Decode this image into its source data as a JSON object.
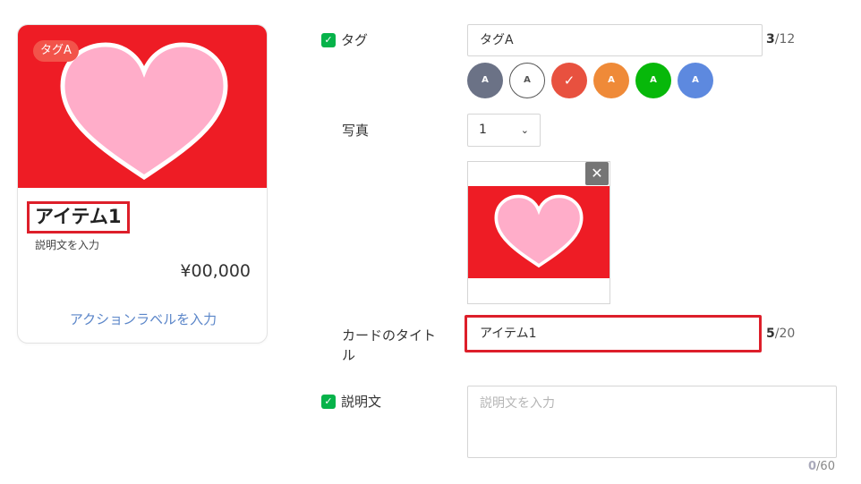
{
  "preview_card": {
    "tag": "タグA",
    "title": "アイテム1",
    "description": "説明文を入力",
    "price": "¥00,000",
    "action_label": "アクションラベルを入力"
  },
  "form": {
    "tag": {
      "label": "タグ",
      "value": "タグA",
      "counter_current": "3",
      "counter_max": "/12",
      "enabled": true
    },
    "tag_colors": [
      {
        "text": "A",
        "color": "#6b7286",
        "selected": false
      },
      {
        "text": "A",
        "color": "#ffffff",
        "selected": false
      },
      {
        "text": "✓",
        "color": "#e8513f",
        "selected": true
      },
      {
        "text": "A",
        "color": "#ef8a38",
        "selected": false
      },
      {
        "text": "A",
        "color": "#07b80a",
        "selected": false
      },
      {
        "text": "A",
        "color": "#5d89df",
        "selected": false
      }
    ],
    "photo": {
      "label": "写真",
      "count_value": "1"
    },
    "card_title": {
      "label_line1": "カードのタイト",
      "label_line2": "ル",
      "value": "アイテム1",
      "counter_current": "5",
      "counter_max": "/20"
    },
    "description": {
      "label": "説明文",
      "placeholder": "説明文を入力",
      "counter_current": "0",
      "counter_max": "/60",
      "enabled": true
    }
  },
  "colors": {
    "image_background": "#ee1c25",
    "heart_fill": "#ffadc9",
    "highlight_border": "#dd1f2a",
    "checkbox_green": "#06b34a",
    "action_link": "#5b86c9"
  }
}
